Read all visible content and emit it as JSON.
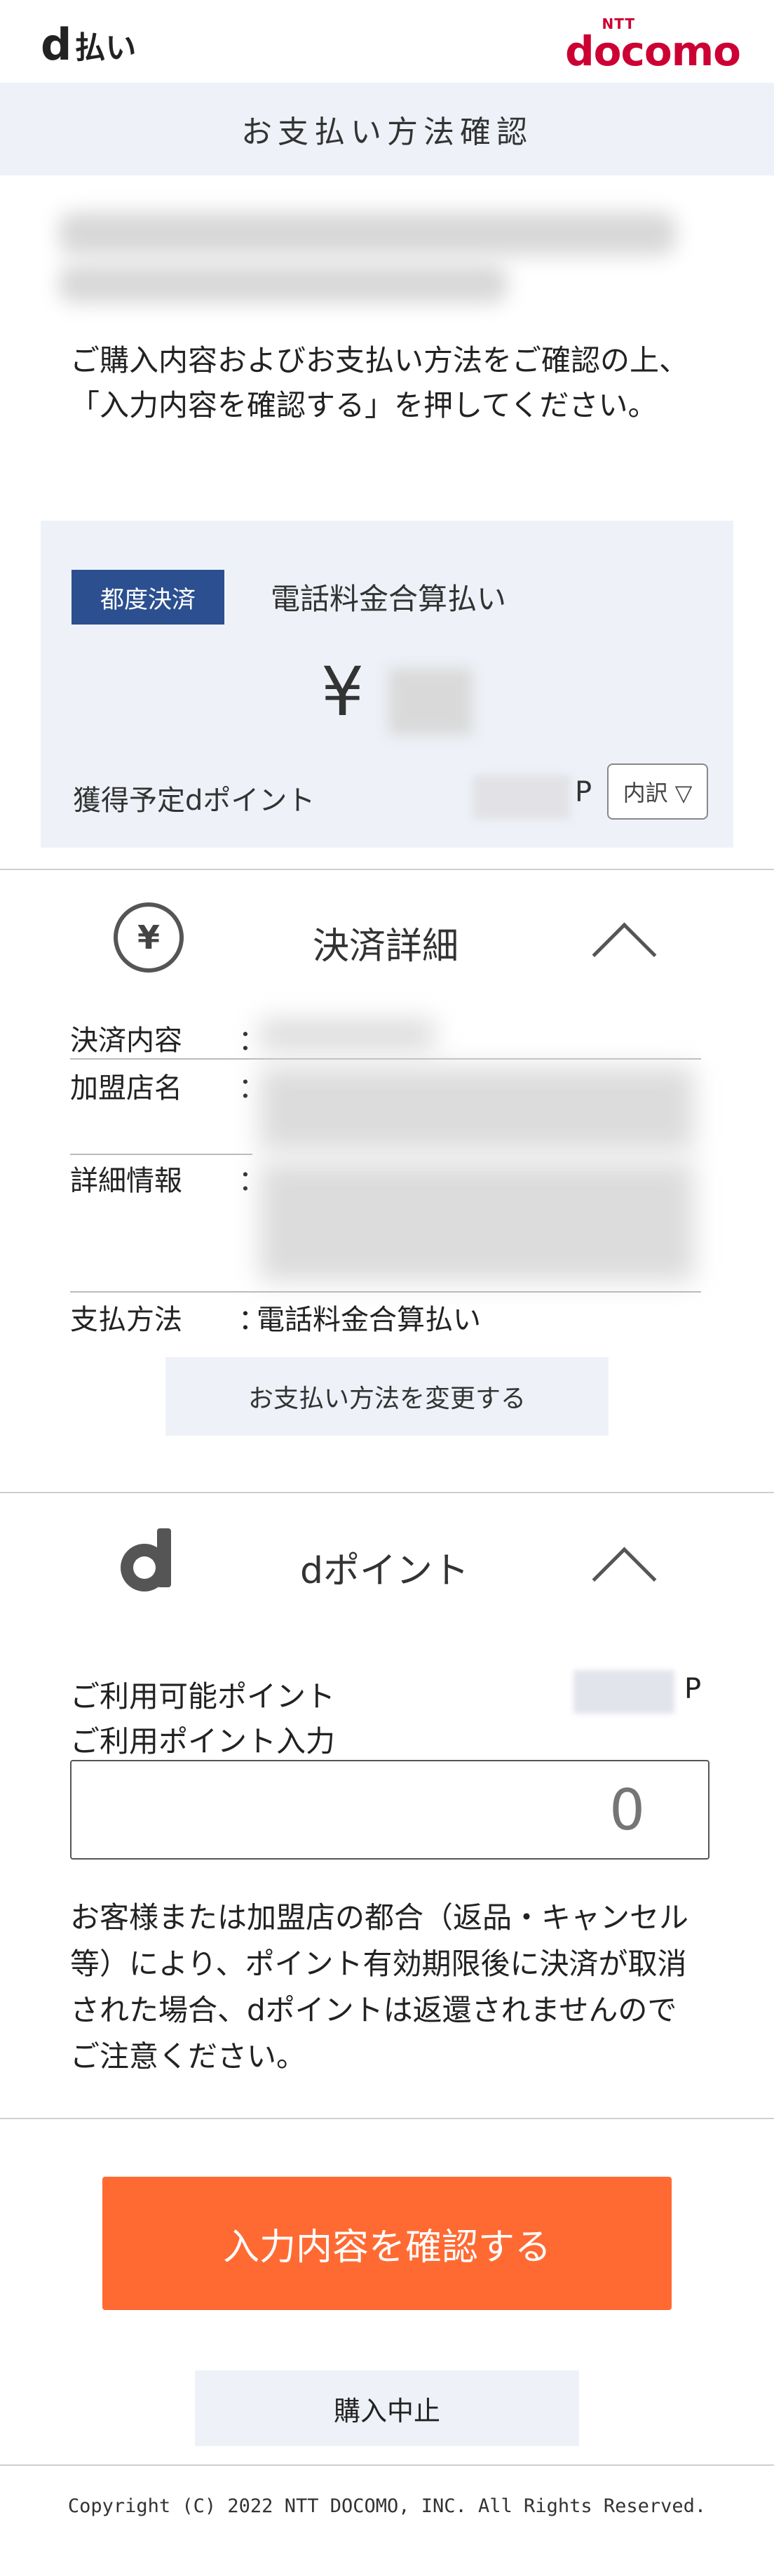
{
  "header": {
    "dpay_logo_letter": "d",
    "dpay_logo_text": "払い",
    "docomo_ntt": "NTT",
    "docomo_word": "docomo",
    "page_title": "お支払い方法確認"
  },
  "intro": {
    "text": "ご購入内容およびお支払い方法をご確認の上、「入力内容を確認する」を押してください。"
  },
  "summary": {
    "badge": "都度決済",
    "payment_method": "電話料金合算払い",
    "currency_symbol": "¥",
    "earn_points_label": "獲得予定dポイント",
    "points_unit": "P",
    "breakdown_button": "内訳 ▽"
  },
  "settlement": {
    "icon": "yen-circle-icon",
    "title": "決済詳細",
    "content_label": "決済内容",
    "merchant_label": "加盟店名",
    "detail_label": "詳細情報",
    "method_label": "支払方法",
    "colon": "：",
    "method_value": "電話料金合算払い",
    "change_button": "お支払い方法を変更する"
  },
  "dpoint": {
    "icon": "dpoint-logo-icon",
    "title": "dポイント",
    "available_label": "ご利用可能ポイント",
    "points_unit": "P",
    "input_label": "ご利用ポイント入力",
    "input_placeholder": "0",
    "notice": "お客様または加盟店の都合（返品・キャンセル等）により、ポイント有効期限後に決済が取消された場合、dポイントは返還されませんのでご注意ください。"
  },
  "actions": {
    "confirm_button": "入力内容を確認する",
    "cancel_button": "購入中止"
  },
  "footer": {
    "copyright": "Copyright (C) 2022 NTT DOCOMO, INC. All Rights Reserved."
  },
  "colors": {
    "accent_orange": "#ff6a33",
    "badge_navy": "#2b4f8f",
    "docomo_red": "#cc0033",
    "panel_bg": "#eef2f8"
  }
}
